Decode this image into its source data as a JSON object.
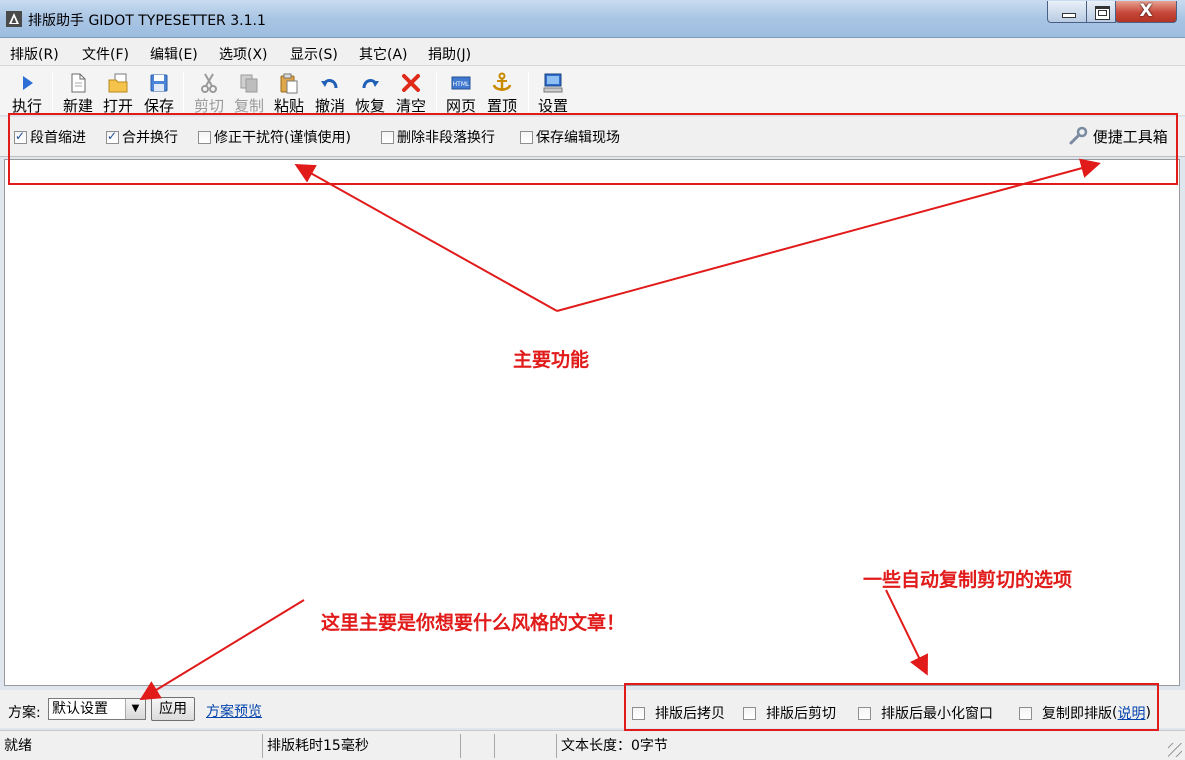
{
  "window": {
    "title": "排版助手 GIDOT TYPESETTER 3.1.1",
    "close_glyph": "X"
  },
  "menu": [
    "排版(R)",
    "文件(F)",
    "编辑(E)",
    "选项(X)",
    "显示(S)",
    "其它(A)",
    "捐助(J)"
  ],
  "toolbar": {
    "run": "执行",
    "new": "新建",
    "open": "打开",
    "save": "保存",
    "cut": "剪切",
    "copy": "复制",
    "paste": "粘贴",
    "undo": "撤消",
    "redo": "恢复",
    "clear": "清空",
    "webpage": "网页",
    "pin_top": "置顶",
    "settings": "设置"
  },
  "options": [
    {
      "label": "段首缩进",
      "checked": true
    },
    {
      "label": "合并换行",
      "checked": true
    },
    {
      "label": "修正干扰符(谨慎使用)",
      "checked": false
    },
    {
      "label": "删除非段落换行",
      "checked": false
    },
    {
      "label": "保存编辑现场",
      "checked": false
    }
  ],
  "toolbox_label": "便捷工具箱",
  "scheme": {
    "label": "方案:",
    "selected": "默认设置",
    "apply": "应用",
    "preview": "方案预览"
  },
  "auto_options": [
    {
      "label": "排版后拷贝",
      "checked": false
    },
    {
      "label": "排版后剪切",
      "checked": false
    },
    {
      "label": "排版后最小化窗口",
      "checked": false
    },
    {
      "label": "复制即排版",
      "checked": false
    }
  ],
  "help": {
    "open_paren": "(",
    "link": "说明",
    "close_paren": ")"
  },
  "status": {
    "ready": "就绪",
    "time": "排版耗时15毫秒",
    "blank1": "",
    "blank2": "",
    "length": "文本长度：0字节"
  },
  "annotations": {
    "main": "主要功能",
    "scheme_note": "这里主要是你想要什么风格的文章！",
    "auto_note": "一些自动复制剪切的选项"
  },
  "colors": {
    "annotation_red": "#e11a1a",
    "link_blue": "#0645ad"
  }
}
